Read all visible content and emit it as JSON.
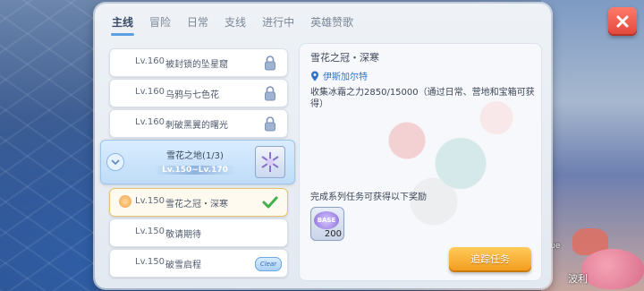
{
  "tabs": [
    {
      "label": "主线",
      "active": true
    },
    {
      "label": "冒险"
    },
    {
      "label": "日常"
    },
    {
      "label": "支线"
    },
    {
      "label": "进行中"
    },
    {
      "label": "英雄赞歌"
    }
  ],
  "quests_top": [
    {
      "level": "Lv.160",
      "name": "被封锁的坠星窟",
      "status": "locked"
    },
    {
      "level": "Lv.160",
      "name": "乌鸦与七色花",
      "status": "locked"
    },
    {
      "level": "Lv.160",
      "name": "刺破黑翼的曙光",
      "status": "locked"
    }
  ],
  "group": {
    "title": "雪花之地(1/3)",
    "range": "Lv.150~Lv.170"
  },
  "quests_bottom": [
    {
      "level": "Lv.150",
      "name": "雪花之冠・深寒",
      "status": "done"
    },
    {
      "level": "Lv.150",
      "name": "敬请期待",
      "status": "none"
    },
    {
      "level": "Lv.150",
      "name": "破雪启程",
      "status": "clear"
    }
  ],
  "clear_badge": "Clear",
  "detail": {
    "title": "雪花之冠・深寒",
    "location": "伊斯加尔特",
    "description": "收集冰霜之力2850/15000（通过日常、营地和宝箱可获得）",
    "reward_label": "完成系列任务可获得以下奖励",
    "reward": {
      "icon": "base-exp-icon",
      "badge": "BASE",
      "count": "200"
    },
    "track_button": "追踪任务"
  },
  "hud": {
    "player_name": "波利",
    "hint": "Que"
  },
  "colors": {
    "accent": "#5b9ee4",
    "close": "#e0473b",
    "track": "#f29b1b",
    "link": "#2f74c9"
  }
}
